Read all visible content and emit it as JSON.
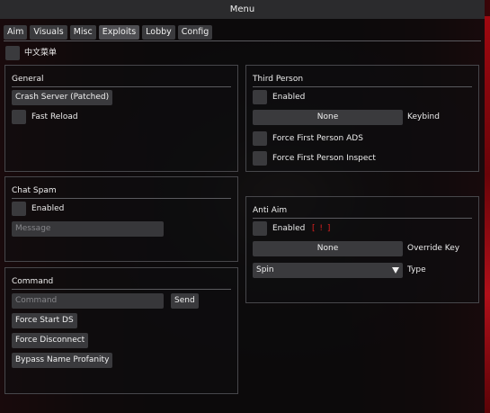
{
  "window": {
    "title": "Menu"
  },
  "tabs": [
    {
      "label": "Aim"
    },
    {
      "label": "Visuals"
    },
    {
      "label": "Misc"
    },
    {
      "label": "Exploits"
    },
    {
      "label": "Lobby"
    },
    {
      "label": "Config"
    }
  ],
  "active_tab": "Exploits",
  "language_toggle": {
    "label": "中文菜单",
    "checked": false
  },
  "general": {
    "title": "General",
    "crash_button": "Crash Server (Patched)",
    "fast_reload": {
      "label": "Fast Reload",
      "checked": false
    }
  },
  "chat_spam": {
    "title": "Chat Spam",
    "enabled": {
      "label": "Enabled",
      "checked": false
    },
    "message": {
      "value": "",
      "placeholder": "Message"
    }
  },
  "command": {
    "title": "Command",
    "input": {
      "value": "",
      "placeholder": "Command"
    },
    "send_button": "Send",
    "force_start_button": "Force Start DS",
    "force_disconnect_button": "Force Disconnect",
    "bypass_button": "Bypass Name Profanity"
  },
  "third_person": {
    "title": "Third Person",
    "enabled": {
      "label": "Enabled",
      "checked": false
    },
    "keybind": {
      "value": "None",
      "label": "Keybind"
    },
    "force_ads": {
      "label": "Force First Person ADS",
      "checked": false
    },
    "force_inspect": {
      "label": "Force First Person Inspect",
      "checked": false
    }
  },
  "anti_aim": {
    "title": "Anti Aim",
    "enabled": {
      "label": "Enabled",
      "checked": false
    },
    "warning": "[ ! ]",
    "override_key": {
      "value": "None",
      "label": "Override Key"
    },
    "type": {
      "value": "Spin",
      "label": "Type"
    }
  },
  "colors": {
    "accent_warning": "#e02020",
    "control_bg": "#3a3a3d",
    "titlebar_bg": "#2b2b2d"
  }
}
